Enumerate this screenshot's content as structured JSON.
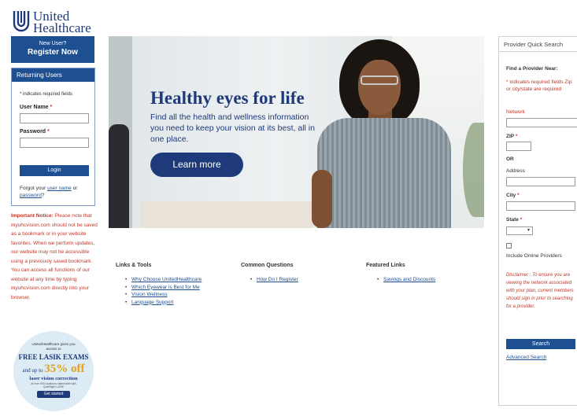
{
  "brand": {
    "line1": "United",
    "line2": "Healthcare",
    "color": "#1f3a7a"
  },
  "register": {
    "question": "New User?",
    "label": "Register Now"
  },
  "login": {
    "title": "Returning Users",
    "required_note": "* indicates required fields",
    "username_label": "User Name",
    "password_label": "Password",
    "required_mark": "*",
    "button": "Login",
    "forgot_prefix": "Forgot your",
    "forgot_user": "user name",
    "forgot_or": "or",
    "forgot_pass": "password",
    "forgot_suffix": "?"
  },
  "notice": {
    "label": "Important Notice:",
    "text": "Please note that myuhcvision.com should not be saved as a bookmark or in your website favorites. When we perform updates, our website may not be accessible using a previously saved bookmark. You can access all functions of our website at any time by typing myuhcvision.com directly into your browser."
  },
  "promo": {
    "intro": "UnitedHealthcare gives you access to",
    "headline": "FREE LASIK EXAMS",
    "discount_prefix": "and up to",
    "discount": "35% off",
    "detail": "laser vision correction",
    "fine_print": "at over 900 locations nationwide with QualSight LASIK",
    "button": "Get started"
  },
  "hero": {
    "title": "Healthy eyes for life",
    "subtitle": "Find all the health and wellness information you need to keep your vision at its best, all in one place.",
    "cta": "Learn more"
  },
  "links_tools": {
    "title": "Links & Tools",
    "items": [
      "Why Choose UnitedHealthcare",
      "Which Eyewear is Best for Me",
      "Vision Wellness",
      "Language Support"
    ]
  },
  "common_questions": {
    "title": "Common Questions",
    "items": [
      "How Do I Register"
    ]
  },
  "featured_links": {
    "title": "Featured Links",
    "items": [
      "Savings and Discounts"
    ]
  },
  "provider_search": {
    "title": "Provider Quick Search",
    "find_label": "Find a Provider Near:",
    "required_note": "* indicates required fields Zip or city/state are required",
    "network_label": "Network",
    "zip_label": "ZIP",
    "or_label": "OR",
    "address_label": "Address",
    "city_label": "City",
    "state_label": "State",
    "required_mark": "*",
    "state_value": "",
    "online_label": "Include Online Providers",
    "disclaimer": "Disclaimer : To ensure you are viewing the network associated with your plan, current members should sign in prior to searching for a provider.",
    "search_button": "Search",
    "advanced_link": "Advanced Search"
  }
}
